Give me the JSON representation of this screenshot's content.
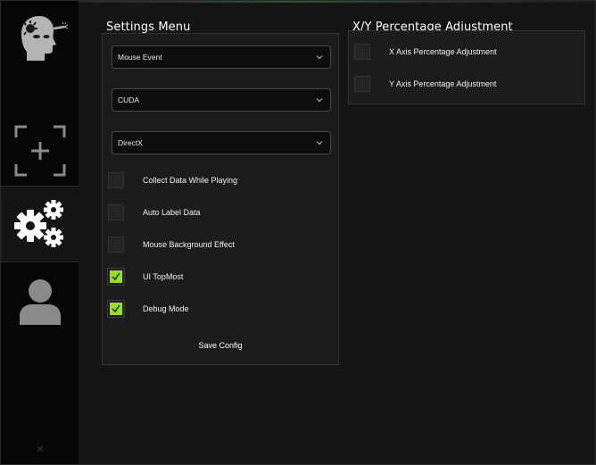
{
  "sidebar": {
    "items": [
      {
        "name": "aim-icon"
      },
      {
        "name": "capture-icon"
      },
      {
        "name": "settings-icon",
        "active": true
      },
      {
        "name": "user-icon"
      }
    ],
    "close_glyph": "×"
  },
  "settings": {
    "title": "Settings Menu",
    "dropdowns": [
      {
        "value": "Mouse Event"
      },
      {
        "value": "CUDA"
      },
      {
        "value": "DirectX"
      }
    ],
    "checkboxes": [
      {
        "label": "Collect Data While Playing",
        "checked": false
      },
      {
        "label": "Auto Label Data",
        "checked": false
      },
      {
        "label": "Mouse Background Effect",
        "checked": false
      },
      {
        "label": "UI TopMost",
        "checked": true
      },
      {
        "label": "Debug Mode",
        "checked": true
      }
    ],
    "save_label": "Save Config"
  },
  "xy": {
    "title": "X/Y Percentage Adjustment",
    "checkboxes": [
      {
        "label": "X Axis Percentage Adjustment",
        "checked": false
      },
      {
        "label": "Y Axis Percentage Adjustment",
        "checked": false
      }
    ]
  },
  "colors": {
    "accent": "#96e01e",
    "background": "#151515",
    "panel": "#1c1c1c",
    "sidebar": "#070707"
  }
}
